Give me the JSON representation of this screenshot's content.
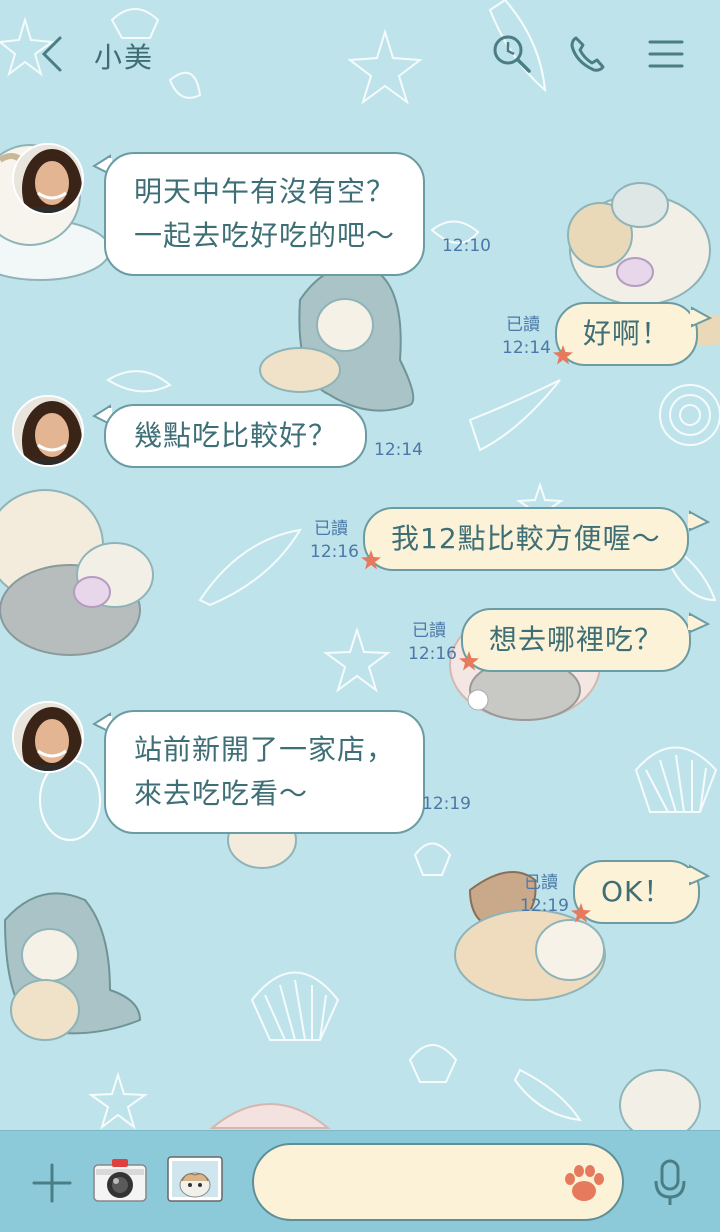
{
  "header": {
    "title": "小美",
    "icons": [
      "back-chevron-icon",
      "search-icon",
      "phone-icon",
      "menu-icon"
    ]
  },
  "messages": [
    {
      "side": "in",
      "lines": [
        "明天中午有沒有空？",
        "一起去吃好吃的吧～"
      ],
      "time": "12:10"
    },
    {
      "side": "out",
      "lines": [
        "好啊！"
      ],
      "read": "已讀",
      "time": "12:14"
    },
    {
      "side": "in",
      "lines": [
        "幾點吃比較好？"
      ],
      "time": "12:14"
    },
    {
      "side": "out",
      "lines": [
        "我12點比較方便喔～"
      ],
      "read": "已讀",
      "time": "12:16"
    },
    {
      "side": "out",
      "lines": [
        "想去哪裡吃？"
      ],
      "read": "已讀",
      "time": "12:16"
    },
    {
      "side": "in",
      "lines": [
        "站前新開了一家店，",
        "來去吃吃看～"
      ],
      "time": "12:19"
    },
    {
      "side": "out",
      "lines": [
        "OK！"
      ],
      "read": "已讀",
      "time": "12:19"
    }
  ],
  "bottom_bar": {
    "input_value": "",
    "icons": [
      "plus-icon",
      "camera-icon",
      "image-icon",
      "paw-icon",
      "microphone-icon"
    ]
  },
  "colors": {
    "background": "#bfe3eb",
    "bubble_in": "#ffffff",
    "bubble_out": "#fbf2d8",
    "bubble_border": "#6b9ba3",
    "text": "#3e6e76",
    "time_text": "#4a78a8",
    "bottom_bar": "#8ccad9",
    "accent_star": "#e57a5c"
  }
}
